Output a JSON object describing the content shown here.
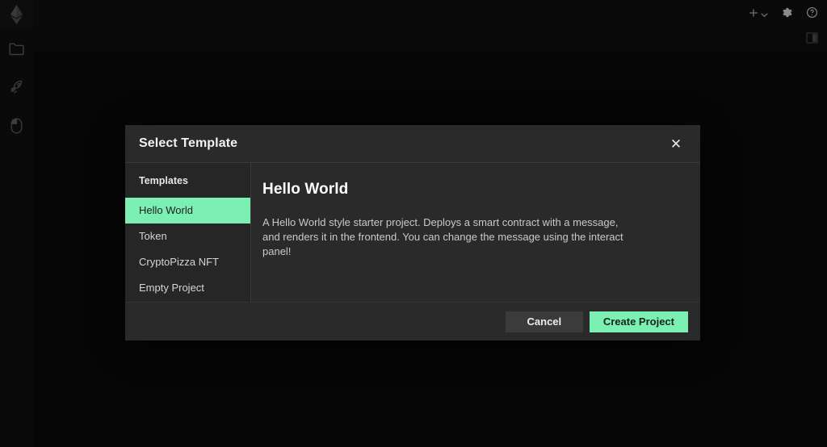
{
  "rail": {
    "logo": {
      "name": "ethereum-logo",
      "label": "Ethereum"
    },
    "items": [
      {
        "icon": "folder-icon",
        "label": "Files"
      },
      {
        "icon": "rocket-icon",
        "label": "Deploy"
      },
      {
        "icon": "mouse-icon",
        "label": "Interact"
      }
    ]
  },
  "topbar": {
    "add_label": "+",
    "add_icon": "plus-icon",
    "add_chevron_icon": "chevron-down-icon",
    "settings_icon": "gear-icon",
    "help_icon": "help-circle-icon"
  },
  "subbar": {
    "panel_toggle_icon": "panel-layout-icon"
  },
  "modal": {
    "title": "Select Template",
    "close_label": "✕",
    "sidebar": {
      "section_label": "Templates",
      "items": [
        {
          "label": "Hello World",
          "selected": true
        },
        {
          "label": "Token",
          "selected": false
        },
        {
          "label": "CryptoPizza NFT",
          "selected": false
        },
        {
          "label": "Empty Project",
          "selected": false
        }
      ]
    },
    "detail": {
      "title": "Hello World",
      "description": "A Hello World style starter project. Deploys a smart contract with a message, and renders it in the frontend. You can change the message using the interact panel!"
    },
    "footer": {
      "cancel_label": "Cancel",
      "create_label": "Create Project"
    }
  },
  "colors": {
    "accent_green": "#7cefb3",
    "modal_bg": "#2a2a2a",
    "modal_sidebar_bg": "#262626",
    "app_bg": "#060607",
    "rail_bg": "#0a0a0b"
  }
}
